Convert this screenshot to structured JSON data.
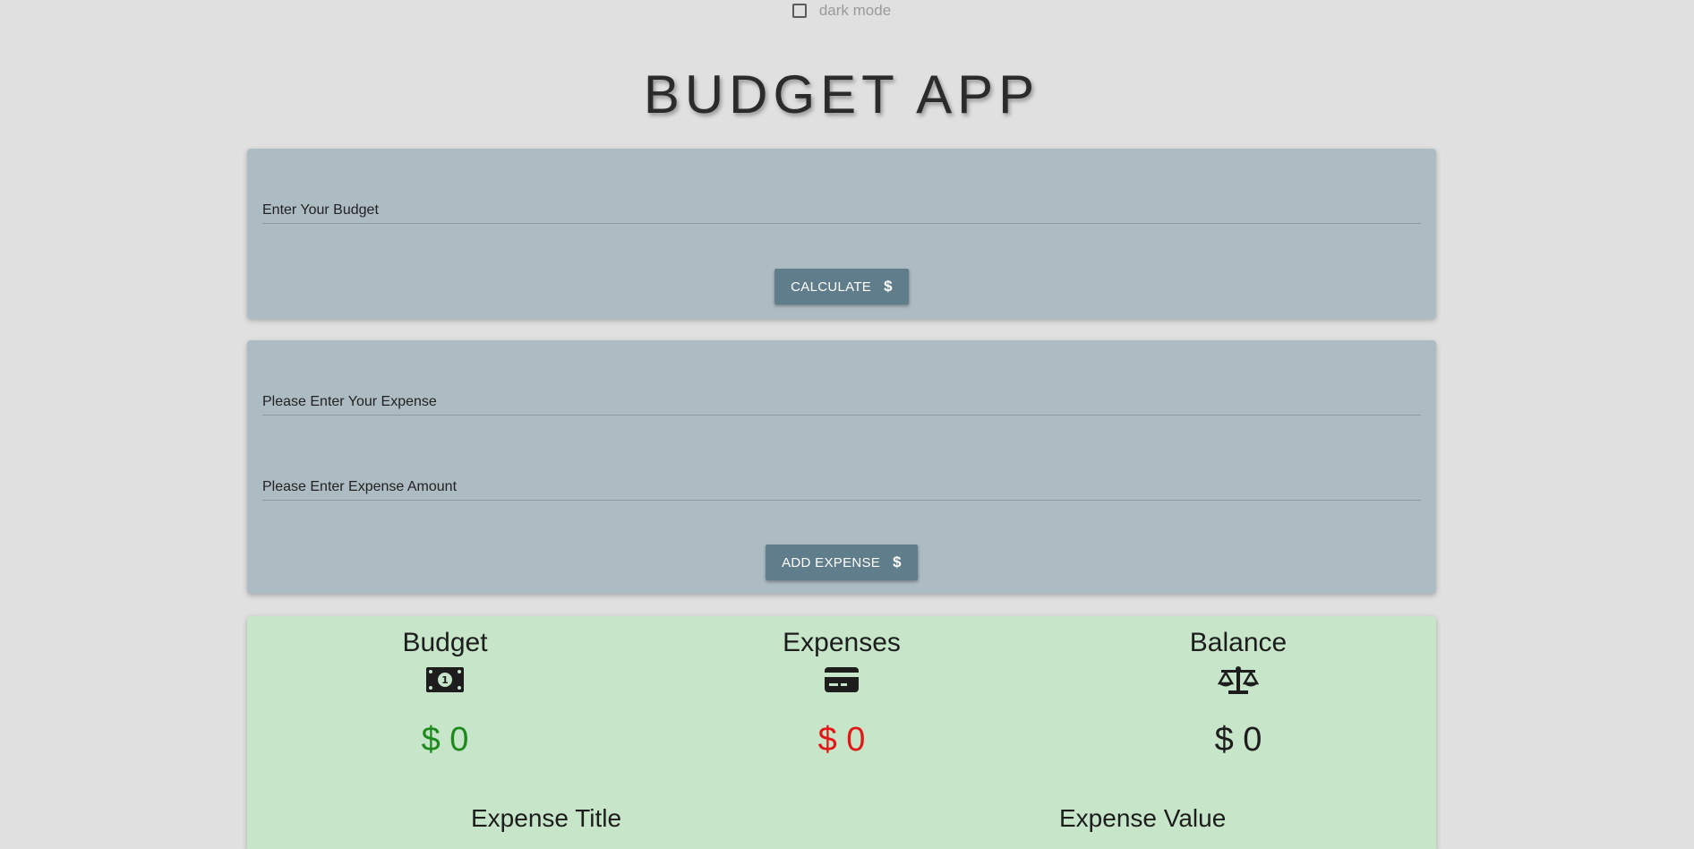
{
  "dark_mode": {
    "label": "dark mode",
    "checked": false
  },
  "title": "BUDGET APP",
  "budget_form": {
    "placeholder": "Enter Your Budget",
    "button_label": "CALCULATE",
    "button_icon": "dollar-icon"
  },
  "expense_form": {
    "title_placeholder": "Please Enter Your Expense",
    "amount_placeholder": "Please Enter Expense Amount",
    "button_label": "ADD EXPENSE",
    "button_icon": "dollar-icon"
  },
  "summary": {
    "budget": {
      "label": "Budget",
      "icon": "money-bill-icon",
      "amount": "$ 0",
      "color": "#1e8a1e"
    },
    "expenses": {
      "label": "Expenses",
      "icon": "credit-card-icon",
      "amount": "$ 0",
      "color": "#e21818"
    },
    "balance": {
      "label": "Balance",
      "icon": "balance-scale-icon",
      "amount": "$ 0",
      "color": "#1d1d1d"
    }
  },
  "expense_list": {
    "headers": [
      "Expense Title",
      "Expense Value"
    ]
  },
  "colors": {
    "background": "#e0e0e0",
    "card": "#adbbc3",
    "button": "#5f7d8b",
    "summary": "#c6e5c9"
  }
}
